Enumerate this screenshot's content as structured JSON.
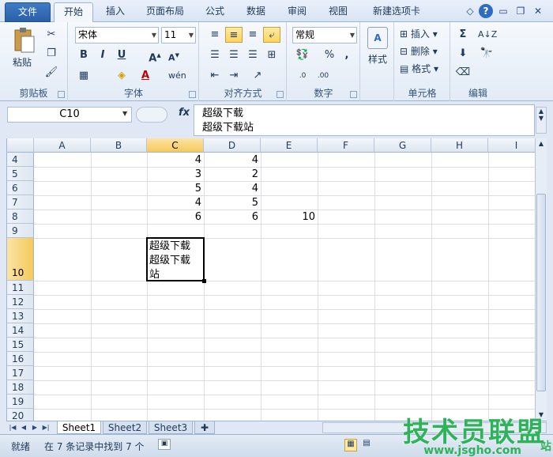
{
  "tabs": [
    "文件",
    "开始",
    "插入",
    "页面布局",
    "公式",
    "数据",
    "审阅",
    "视图",
    "新建选项卡"
  ],
  "ribbon": {
    "clipboard": {
      "paste": "粘贴",
      "title": "剪贴板"
    },
    "font": {
      "name": "宋体",
      "size": "11",
      "title": "字体",
      "bold": "B",
      "italic": "I",
      "underline": "U"
    },
    "alignment": {
      "title": "对齐方式"
    },
    "number": {
      "format": "常规",
      "title": "数字",
      "percent": "%",
      "comma": ","
    },
    "styles": {
      "label": "样式"
    },
    "cells": {
      "insert": "插入",
      "delete": "删除",
      "format": "格式",
      "title": "单元格"
    },
    "editing": {
      "title": "编辑",
      "sum": "Σ"
    }
  },
  "formula_bar": {
    "name_box": "C10",
    "fx": "fx",
    "line1": "超级下载",
    "line2": "超级下载站"
  },
  "grid": {
    "columns": [
      "A",
      "B",
      "C",
      "D",
      "E",
      "F",
      "G",
      "H",
      "I"
    ],
    "rows": [
      "4",
      "5",
      "6",
      "7",
      "8",
      "9",
      "10",
      "11",
      "12",
      "13",
      "14",
      "15",
      "16",
      "17",
      "18",
      "19",
      "20"
    ],
    "c_values": [
      "4",
      "3",
      "5",
      "4",
      "6"
    ],
    "d_values": [
      "4",
      "2",
      "4",
      "5",
      "6"
    ],
    "e8": "10",
    "active_cell_lines": [
      "超级下载",
      "超级下载",
      "站"
    ]
  },
  "sheets": [
    "Sheet1",
    "Sheet2",
    "Sheet3"
  ],
  "status": {
    "ready": "就绪",
    "message": "在 7 条记录中找到 7 个"
  },
  "watermark": {
    "text": "技术员联盟",
    "url": "www.jsgho.com",
    "suffix": "站"
  }
}
